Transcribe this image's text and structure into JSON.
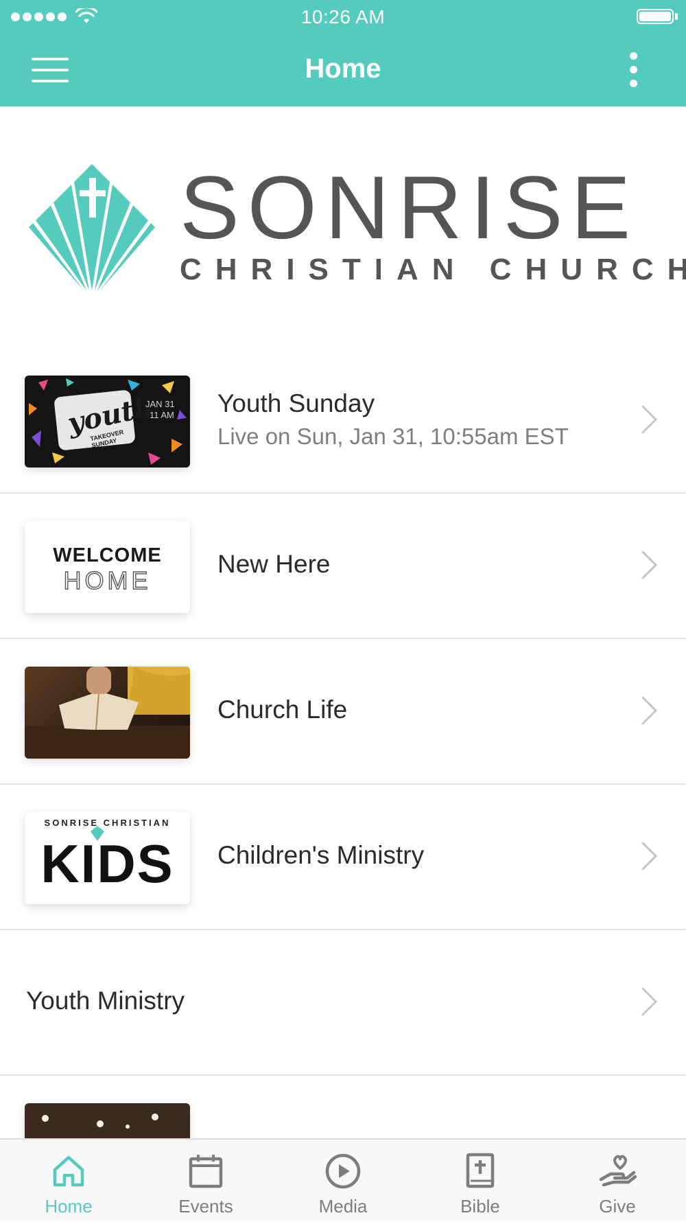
{
  "colors": {
    "accent": "#55cbbd",
    "text_primary": "#2b2b2b",
    "text_secondary": "#7e7e7e",
    "logo_gray": "#555555",
    "tab_inactive": "#7d7d7d"
  },
  "status_bar": {
    "time": "10:26 AM",
    "icons": [
      "signal-dots-icon",
      "wifi-icon",
      "battery-icon"
    ]
  },
  "nav": {
    "title": "Home",
    "left_icon": "hamburger-menu-icon",
    "right_icon": "more-vertical-icon"
  },
  "logo": {
    "name": "SONRISE",
    "subtitle": "CHRISTIAN CHURCH"
  },
  "list": {
    "items": [
      {
        "title": "Youth Sunday",
        "subtitle": "Live on Sun, Jan 31, 10:55am EST",
        "thumb_script": "youth",
        "thumb_caption": "TAKEOVER SUNDAY",
        "thumb_date": "JAN 31",
        "thumb_time": "11 AM"
      },
      {
        "title": "New Here",
        "thumb_line1": "WELCOME",
        "thumb_line2": "HOME"
      },
      {
        "title": "Church Life"
      },
      {
        "title": "Children's Ministry",
        "thumb_line1": "SONRISE CHRISTIAN",
        "thumb_line2": "KIDS"
      },
      {
        "title": "Youth Ministry"
      }
    ]
  },
  "tabbar": {
    "tabs": [
      {
        "label": "Home",
        "icon": "home-icon",
        "active": true
      },
      {
        "label": "Events",
        "icon": "calendar-icon",
        "active": false
      },
      {
        "label": "Media",
        "icon": "play-circle-icon",
        "active": false
      },
      {
        "label": "Bible",
        "icon": "bible-icon",
        "active": false
      },
      {
        "label": "Give",
        "icon": "heart-hand-icon",
        "active": false
      }
    ]
  }
}
